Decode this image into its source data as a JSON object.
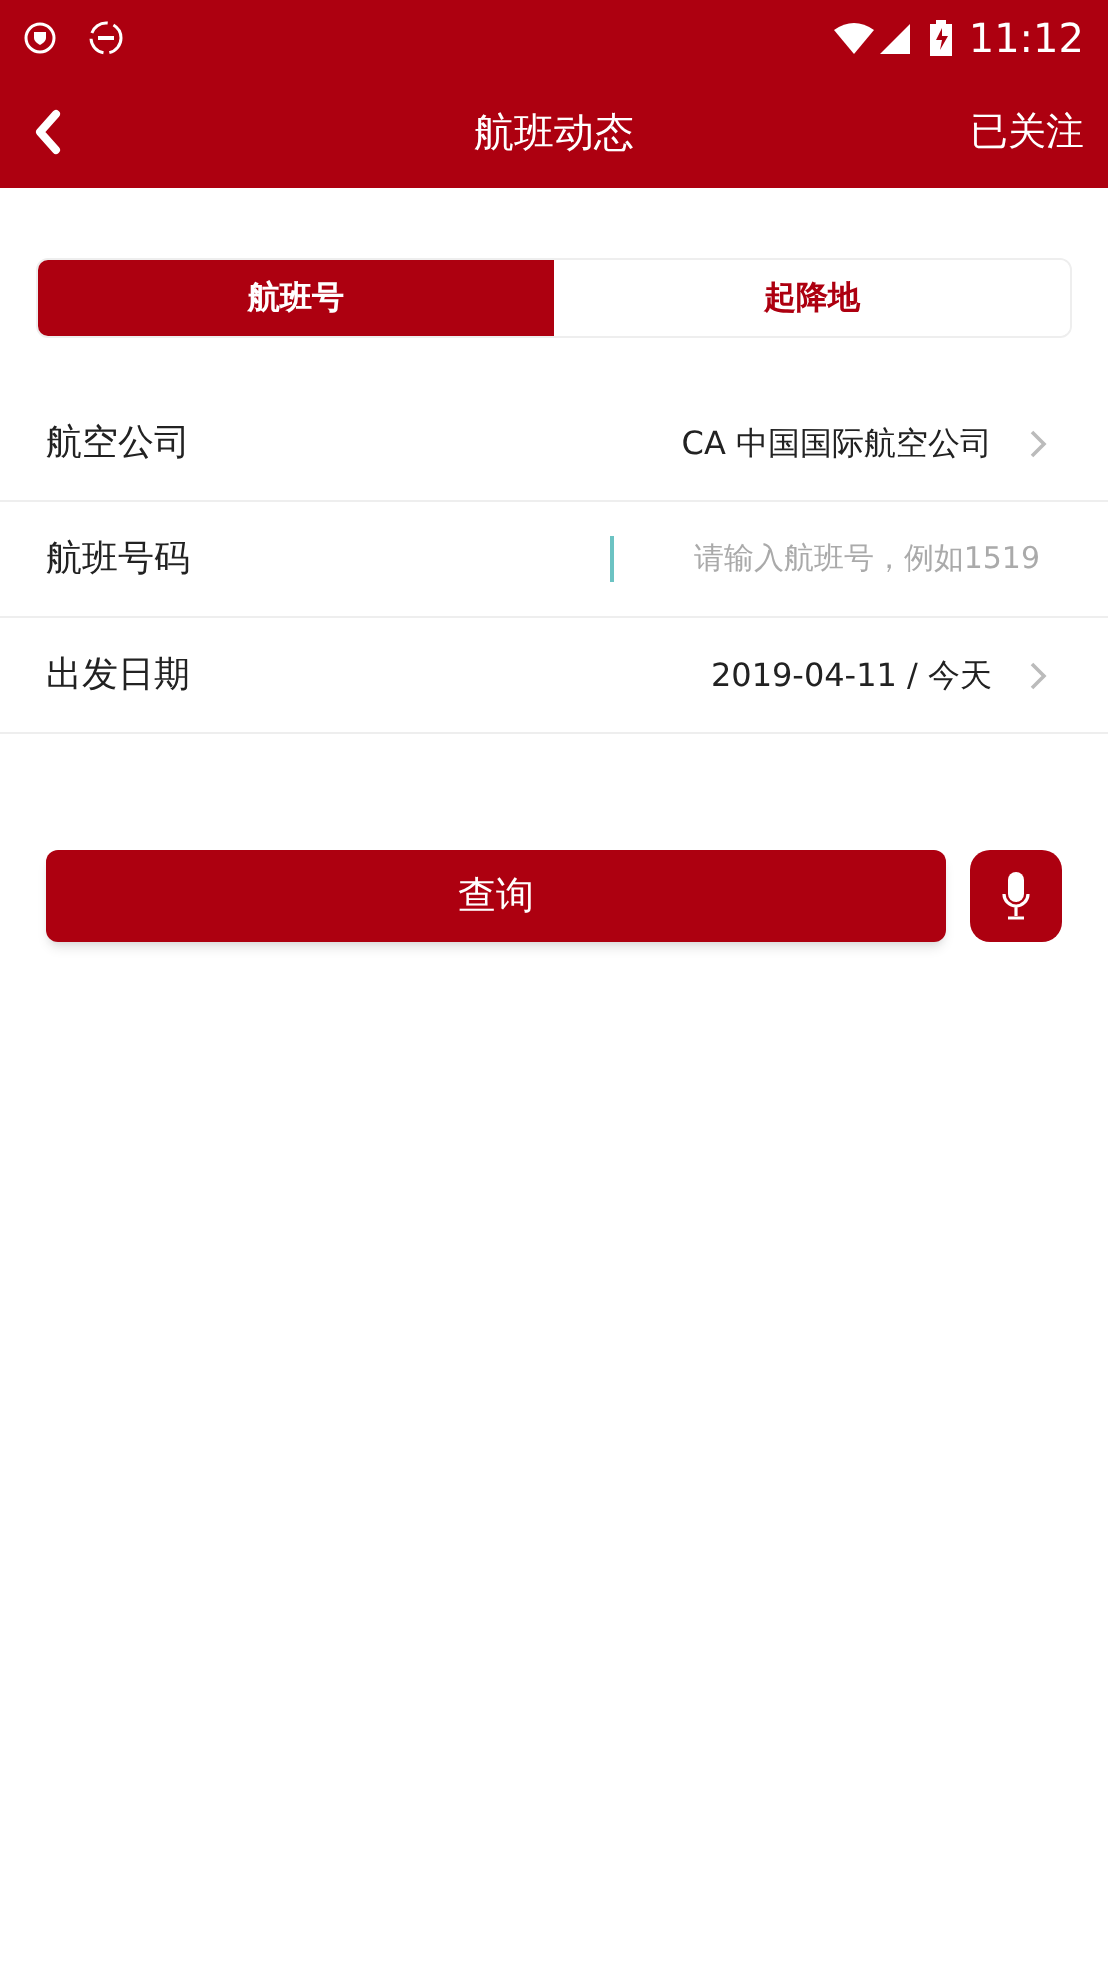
{
  "status_bar": {
    "time": "11:12"
  },
  "header": {
    "title": "航班动态",
    "action": "已关注"
  },
  "tabs": [
    {
      "label": "航班号",
      "selected": true
    },
    {
      "label": "起降地",
      "selected": false
    }
  ],
  "form_rows": [
    {
      "kind": "select",
      "label": "航空公司",
      "value": "CA 中国国际航空公司"
    },
    {
      "kind": "input",
      "label": "航班号码",
      "placeholder": "请输入航班号，例如1519"
    },
    {
      "kind": "select",
      "label": "出发日期",
      "value": "2019-04-11 / 今天"
    }
  ],
  "search_button": {
    "label": "查询"
  }
}
